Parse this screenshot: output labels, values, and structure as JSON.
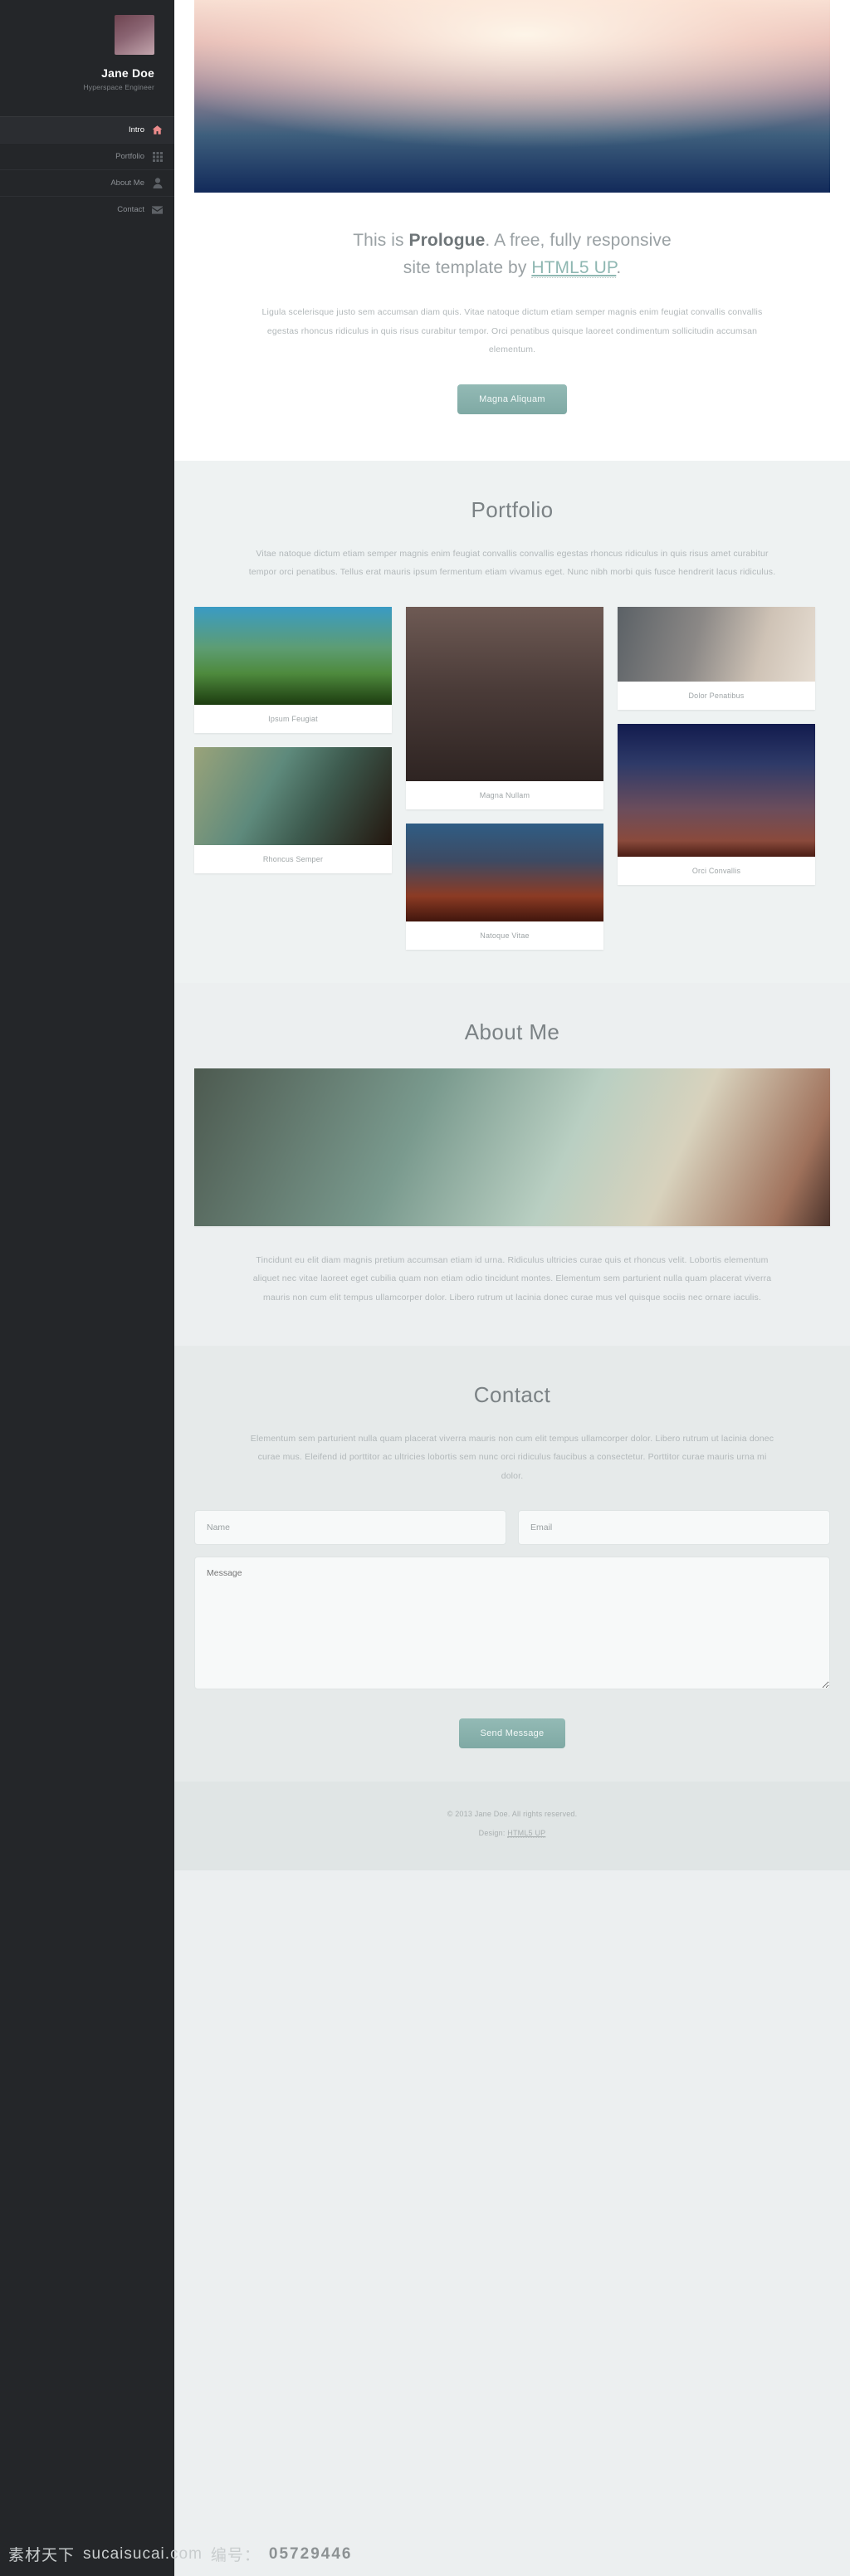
{
  "sidebar": {
    "profile": {
      "name": "Jane Doe",
      "role": "Hyperspace Engineer",
      "avatar_colors": [
        "#6e4450",
        "#c3a5ad"
      ]
    },
    "nav": [
      {
        "label": "Intro",
        "icon": "home-icon",
        "active": true
      },
      {
        "label": "Portfolio",
        "icon": "grid-icon",
        "active": false
      },
      {
        "label": "About Me",
        "icon": "user-icon",
        "active": false
      },
      {
        "label": "Contact",
        "icon": "envelope-icon",
        "active": false
      }
    ],
    "background": "#242629",
    "active_icon_color": "#eb8b8b"
  },
  "intro": {
    "heading_prefix": "This is ",
    "heading_brand": "Prologue",
    "heading_middle": ". A free, fully responsive",
    "heading_line2_prefix": "site template by ",
    "heading_link": "HTML5 UP",
    "heading_suffix": ".",
    "paragraph": "Ligula scelerisque justo sem accumsan diam quis. Vitae natoque dictum etiam semper magnis enim feugiat convallis convallis egestas rhoncus ridiculus in quis risus curabitur tempor. Orci penatibus quisque laoreet condimentum sollicitudin accumsan elementum.",
    "button_label": "Magna Aliquam",
    "button_color": "#8ab3ae"
  },
  "portfolio": {
    "title": "Portfolio",
    "paragraph": "Vitae natoque dictum etiam semper magnis enim feugiat convallis convallis egestas rhoncus ridiculus in quis risus amet curabitur tempor orci penatibus. Tellus erat mauris ipsum fermentum etiam vivamus eget. Nunc nibh morbi quis fusce hendrerit lacus ridiculus.",
    "items": [
      {
        "caption": "Ipsum Feugiat",
        "column": 1,
        "order": 1
      },
      {
        "caption": "Rhoncus Semper",
        "column": 1,
        "order": 2
      },
      {
        "caption": "Magna Nullam",
        "column": 2,
        "order": 1
      },
      {
        "caption": "Natoque Vitae",
        "column": 2,
        "order": 2
      },
      {
        "caption": "Dolor Penatibus",
        "column": 3,
        "order": 1
      },
      {
        "caption": "Orci Convallis",
        "column": 3,
        "order": 2
      }
    ]
  },
  "about": {
    "title": "About Me",
    "paragraph": "Tincidunt eu elit diam magnis pretium accumsan etiam id urna. Ridiculus ultricies curae quis et rhoncus velit. Lobortis elementum aliquet nec vitae laoreet eget cubilia quam non etiam odio tincidunt montes. Elementum sem parturient nulla quam placerat viverra mauris non cum elit tempus ullamcorper dolor. Libero rutrum ut lacinia donec curae mus vel quisque sociis nec ornare iaculis."
  },
  "contact": {
    "title": "Contact",
    "paragraph": "Elementum sem parturient nulla quam placerat viverra mauris non cum elit tempus ullamcorper dolor. Libero rutrum ut lacinia donec curae mus. Eleifend id porttitor ac ultricies lobortis sem nunc orci ridiculus faucibus a consectetur. Porttitor curae mauris urna mi dolor.",
    "name_placeholder": "Name",
    "email_placeholder": "Email",
    "message_placeholder": "Message",
    "name_value": "",
    "email_value": "",
    "message_value": "",
    "submit_label": "Send Message"
  },
  "footer": {
    "copyright": "© 2013 Jane Doe. All rights reserved.",
    "design_prefix": "Design: ",
    "design_link": "HTML5 UP"
  },
  "watermark": {
    "site_cn": "素材天下",
    "site_url": "sucaisucai.com",
    "code_label": "编号：",
    "code_value": "05729446"
  }
}
